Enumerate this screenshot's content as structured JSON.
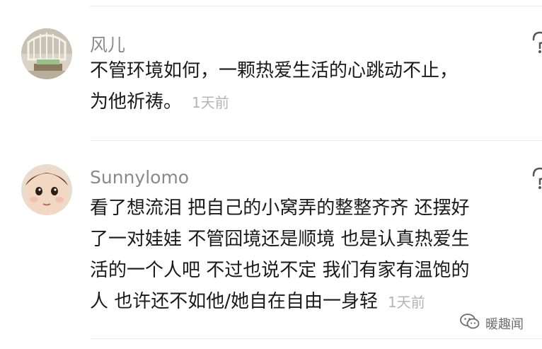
{
  "comments": [
    {
      "username": "风儿",
      "lines": [
        "不管环境如何，一颗热爱生活的心跳动不止，",
        "为他祈祷。"
      ],
      "time": "1天前"
    },
    {
      "username": "Sunnylomo",
      "lines": [
        "看了想流泪 把自己的小窝弄的整整齐齐 还摆好",
        "了一对娃娃 不管囧境还是顺境 也是认真热爱生",
        "活的一个人吧 不过也说不定 我们有家有温饱的",
        "人 也许还不如他/她自在自由一身轻"
      ],
      "time": "1天前"
    }
  ],
  "watermark": {
    "text": "暖趣闻",
    "icon": "wechat-icon"
  },
  "icons": {
    "like": "like-icon"
  }
}
